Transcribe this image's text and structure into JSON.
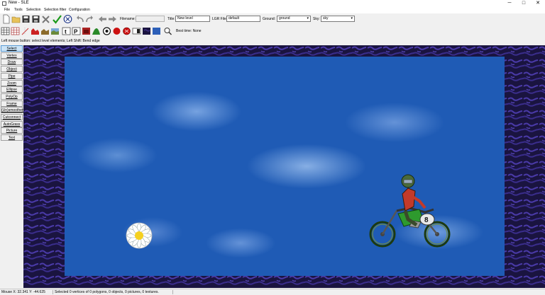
{
  "window": {
    "title": "New - SLE",
    "minimize": "─",
    "maximize": "□",
    "close": "✕"
  },
  "menu": [
    "File",
    "Tools",
    "Selection",
    "Selection filter",
    "Configuration"
  ],
  "toolbar": {
    "filename_label": "Filename:",
    "filename_value": "",
    "title_label": "Title:",
    "title_value": "New level",
    "lgr_label": "LGR File:",
    "lgr_value": "default",
    "ground_label": "Ground:",
    "ground_value": "ground",
    "sky_label": "Sky:",
    "sky_value": "sky",
    "best_time": "Best time: None"
  },
  "hint": "Left mouse button: select level elements; Left Shift: Bend edge",
  "modes": [
    "Select",
    "Vertex",
    "Draw",
    "Object",
    "Pipe",
    "Zoom",
    "Ellipse",
    "PolyOp",
    "Frame",
    "(Un)smoothen",
    "Cutconnect",
    "AutoGrass",
    "Picture",
    "Text"
  ],
  "active_mode": "Select",
  "status": {
    "mouse": "Mouse X: 32.341 Y: -44.625",
    "selection": "Selected 0 vertices of 0 polygons, 0 objects, 0 pictures, 0 textures."
  },
  "colors": {
    "sky": "#1f5bb5",
    "ground": "#1a1440",
    "active_mode": "#cce4f7"
  },
  "icons_row1": [
    "new-file-icon",
    "open-folder-icon",
    "save-icon",
    "save-as-icon",
    "delete-icon",
    "check-topology-icon",
    "play-icon",
    "undo-icon",
    "redo-icon",
    "previous-level-icon",
    "next-level-icon"
  ],
  "icons_row2": [
    "grid-icon",
    "grid-snap-icon",
    "ruler-icon",
    "red-polygon-icon",
    "ground-texture-icon",
    "sky-texture-icon",
    "text-icon",
    "picture-icon",
    "apple-icon",
    "flower-object-icon",
    "killer-icon",
    "start-object-icon",
    "show-objects-icon",
    "show-pictures-icon",
    "background-icon",
    "zoom-fill-icon",
    "zoom-icon"
  ]
}
